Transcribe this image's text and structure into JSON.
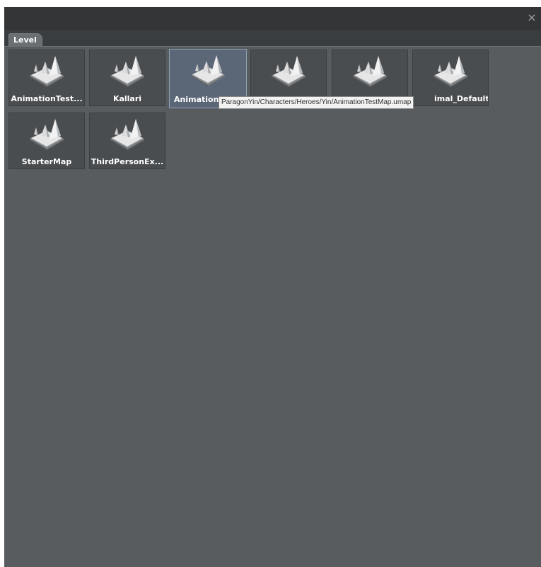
{
  "window": {
    "close_glyph": "×",
    "tab_label": "Level"
  },
  "tiles": [
    {
      "label": "AnimationTest...",
      "icon": "level-map-icon",
      "selected": false
    },
    {
      "label": "Kallari",
      "icon": "level-map-icon",
      "selected": false
    },
    {
      "label": "Animation",
      "icon": "level-map-icon",
      "selected": true
    },
    {
      "label": "",
      "icon": "level-map-icon",
      "selected": false
    },
    {
      "label": "",
      "icon": "level-map-icon",
      "selected": false
    },
    {
      "label": "imal_Default",
      "icon": "level-map-icon",
      "selected": false
    },
    {
      "label": "StarterMap",
      "icon": "level-map-icon",
      "selected": false
    },
    {
      "label": "ThirdPersonEx...",
      "icon": "level-map-icon",
      "selected": false
    }
  ],
  "tooltip": {
    "text": "ParagonYin/Characters/Heroes/Yin/AnimationTestMap.umap"
  },
  "colors": {
    "panel_bg": "#595c5e",
    "tile_bg": "#4a4d50",
    "tile_selected_bg": "#5b6677",
    "titlebar_bg": "#333537"
  }
}
